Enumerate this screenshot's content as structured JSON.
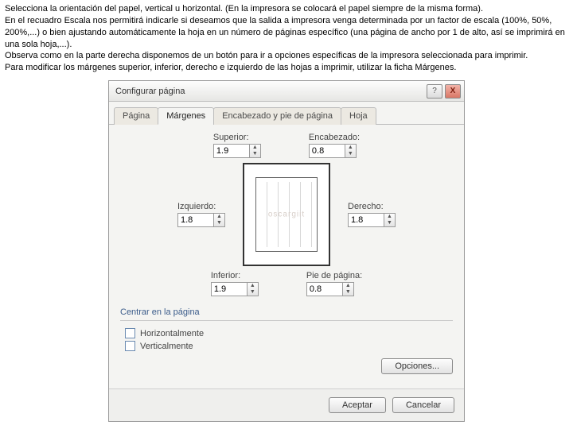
{
  "intro": {
    "p1": "Selecciona la orientación del papel, vertical u horizontal. (En la impresora se colocará el papel siempre de la misma forma).",
    "p2": "En el recuadro Escala nos permitirá indicarle si deseamos que la salida a impresora venga determinada por un factor de escala (100%, 50%, 200%,...) o bien ajustando automáticamente la hoja en un número de páginas específico (una página de ancho por 1 de alto, así se imprimirá en una sola hoja,...).",
    "p3": "Observa como en la parte derecha disponemos de un botón para ir a opciones específicas de la impresora seleccionada para imprimir.",
    "p4": "Para modificar los márgenes superior, inferior, derecho e izquierdo de las hojas a imprimir, utilizar la ficha Márgenes."
  },
  "dialog": {
    "title": "Configurar página",
    "help_icon": "?",
    "close_icon": "X",
    "tabs": [
      "Página",
      "Márgenes",
      "Encabezado y pie de página",
      "Hoja"
    ],
    "labels": {
      "superior": "Superior:",
      "encabezado": "Encabezado:",
      "izquierdo": "Izquierdo:",
      "derecho": "Derecho:",
      "inferior": "Inferior:",
      "pie": "Pie de página:",
      "centrar": "Centrar en la página",
      "horiz": "Horizontalmente",
      "vert": "Verticalmente",
      "opciones": "Opciones...",
      "aceptar": "Aceptar",
      "cancelar": "Cancelar"
    },
    "values": {
      "superior": "1.9",
      "encabezado": "0.8",
      "izquierdo": "1.8",
      "derecho": "1.8",
      "inferior": "1.9",
      "pie": "0.8"
    },
    "watermark": "oscargiit"
  }
}
